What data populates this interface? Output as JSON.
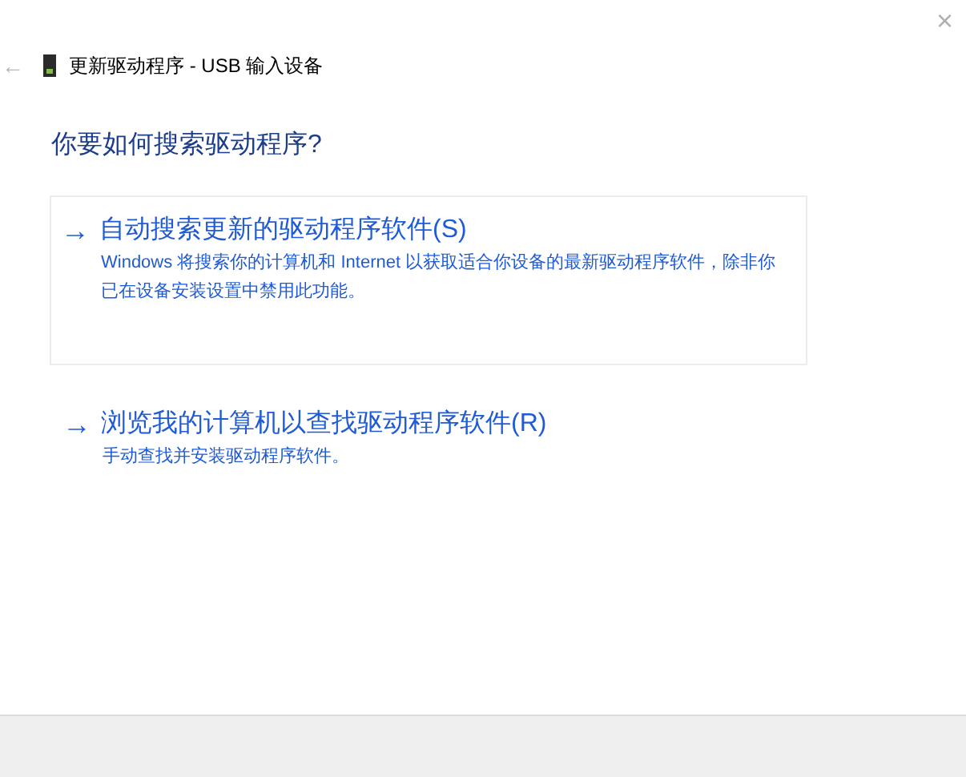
{
  "window": {
    "title": "更新驱动程序 - USB 输入设备",
    "close": "×",
    "back": "←"
  },
  "heading": "你要如何搜索驱动程序?",
  "options": [
    {
      "arrow": "→",
      "title": "自动搜索更新的驱动程序软件(S)",
      "description": "Windows 将搜索你的计算机和 Internet 以获取适合你设备的最新驱动程序软件，除非你已在设备安装设置中禁用此功能。",
      "selected": true
    },
    {
      "arrow": "→",
      "title": "浏览我的计算机以查找驱动程序软件(R)",
      "description": "手动查找并安装驱动程序软件。",
      "selected": false
    }
  ]
}
